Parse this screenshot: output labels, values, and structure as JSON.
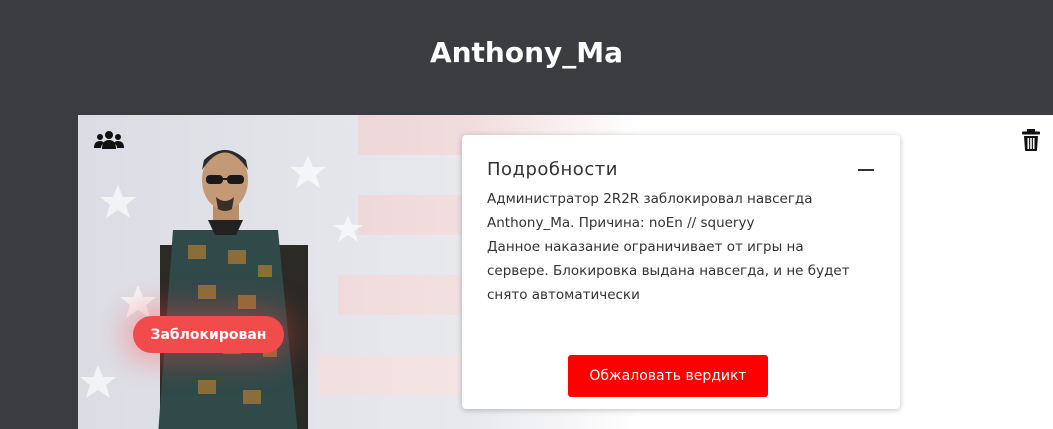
{
  "header": {
    "title": "Anthony_Ma"
  },
  "profile": {
    "status_badge": "Заблокирован",
    "group_icon": "users-icon",
    "delete_icon": "trash-icon"
  },
  "details": {
    "title": "Подробности",
    "collapse_icon": "minus-icon",
    "paragraph_1": "Администратор 2R2R заблокировал навсегда Anthony_Ma. Причина: noEn // squeryy",
    "paragraph_2": "Данное наказание ограничивает от игры на сервере. Блокировка выдана навсегда, и не будет снято автоматически",
    "appeal_button": "Обжаловать вердикт"
  },
  "colors": {
    "header_bg": "#3b3c3f",
    "badge_bg": "#f14b4b",
    "button_bg": "#ff0000"
  }
}
